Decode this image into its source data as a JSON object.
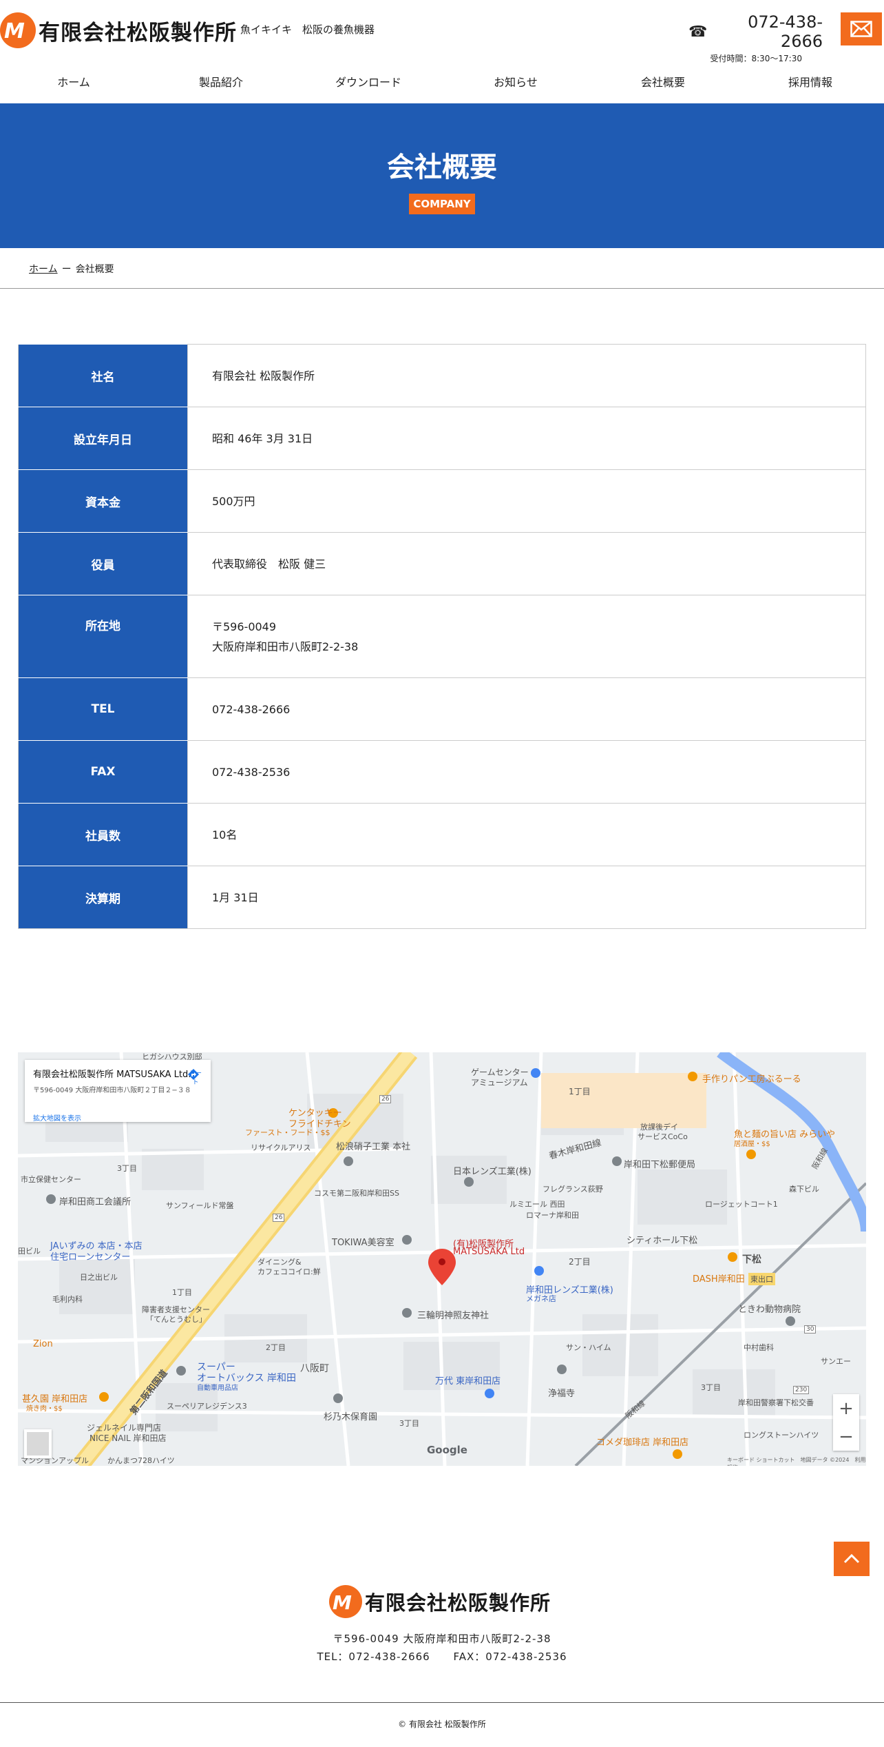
{
  "header": {
    "logo_text": "有限会社松阪製作所",
    "tagline": "魚イキイキ　松阪の養魚機器",
    "phone_icon": "☎",
    "phone": "072-438-2666",
    "hours": "受付時間：8:30〜17:30",
    "mail_icon": "envelope-icon"
  },
  "nav": {
    "items": [
      "ホーム",
      "製品紹介",
      "ダウンロード",
      "お知らせ",
      "会社概要",
      "採用情報"
    ]
  },
  "hero": {
    "title": "会社概要",
    "badge": "COMPANY"
  },
  "breadcrumb": {
    "home": "ホーム",
    "separator": "ー",
    "current": "会社概要"
  },
  "company_table": {
    "rows": [
      {
        "label": "社名",
        "value": "有限会社 松阪製作所"
      },
      {
        "label": "設立年月日",
        "value": "昭和 46年 3月 31日"
      },
      {
        "label": "資本金",
        "value": "500万円"
      },
      {
        "label": "役員",
        "value": "代表取締役　松阪 健三"
      },
      {
        "label": "所在地",
        "value": "〒596-0049",
        "value2": "大阪府岸和田市八阪町2-2-38"
      },
      {
        "label": "TEL",
        "value": "072-438-2666"
      },
      {
        "label": "FAX",
        "value": "072-438-2536"
      },
      {
        "label": "社員数",
        "value": "10名"
      },
      {
        "label": "決算期",
        "value": "1月 31日"
      }
    ]
  },
  "map": {
    "card_title": "有限会社松阪製作所 MATSUSAKA Ltd.",
    "card_address": "〒596-0049 大阪府岸和田市八阪町２丁目２−３８",
    "card_link": "拡大地図を表示",
    "card_directions": "ルート",
    "marker_label_1": "(有)松阪製作所",
    "marker_label_2": "MATSUSAKA Ltd",
    "labels": {
      "kentucky_1": "ケンタッキー",
      "kentucky_2": "フライドチキン",
      "kentucky_3": "ファースト・フード・$$",
      "game": "ゲームセンター",
      "game2": "アミュージアム",
      "chome1": "1丁目",
      "chome3": "3丁目",
      "chome2": "2丁目",
      "pan": "手作りパン工房ぶるーる",
      "matsunami": "松浪硝子工業 本社",
      "nihon_lens": "日本レンズ工業(株)",
      "haruki": "春木岸和田線",
      "post": "岸和田下松郵便局",
      "kishiwada_chamber": "岸和田商工会議所",
      "ja": "JAいずみの 本店・本店",
      "ja2": "住宅ローンセンター",
      "tokiwa": "TOKIWA美容室",
      "lens2": "岸和田レンズ工業(株)",
      "lens3": "メガネ店",
      "citihall": "シティホール下松",
      "shimomatsu": "下松",
      "higashiguchi": "東出口",
      "dash": "DASH岸和田",
      "zoo": "ときわ動物病院",
      "miwa": "三輪明神照友神社",
      "kokudo": "第二阪和国道",
      "super": "スーパー",
      "autobacs": "オートバックス 岸和田",
      "autobacs2": "自動車用品店",
      "yasaka": "八阪町",
      "suginoki": "杉乃木保育園",
      "mandai": "万代 東岸和田店",
      "jofuku": "浄福寺",
      "komeda": "コメダ珈琲店 岸和田店",
      "police": "岸和田警察署下松交番",
      "longstone": "ロングストーンハイツ",
      "sanai": "サンエー",
      "nakamura": "中村歯科",
      "udon": "魚と麺の旨い店 みらいや",
      "udon2": "居酒屋・$$",
      "morishita": "森下ビル",
      "rosejet": "ロージェットコート1",
      "lumiere": "ルミエール 西田",
      "romana": "ロマーナ岸和田",
      "fragrance": "フレグランス荻野",
      "houkago": "放課後デイ",
      "houkago2": "サービスCoCo",
      "recycle": "リサイクルアリス",
      "cosmo": "コスモ第二阪和岸和田SS",
      "sunfield": "サンフィールド常盤",
      "health": "市立保健センター",
      "dining": "ダイニング&",
      "dining2": "カフェココイロ:鮮",
      "hidechi": "日之出ビル",
      "mouri": "毛利内科",
      "shogai": "障害者支援センター",
      "shogai2": "「てんとうむし」",
      "sunheim": "サン・ハイム",
      "superia": "スーペリアレジデンス3",
      "jelnail": "ジェルネイル専門店",
      "nicenail": "NICE NAIL 岸和田店",
      "mansion": "マンションアップル",
      "kanmatsu": "かんまつ728ハイツ",
      "yakiniku": "甚久園 岸和田店",
      "yakiniku2": "焼き肉・$$",
      "zion": "Zion",
      "hankai": "阪和線",
      "road26": "26",
      "road30": "30",
      "road230": "230",
      "hidechibiru": "田ビル",
      "higashi": "ヒガシハウス別邸"
    },
    "google": "Google",
    "footer_text": "キーボード ショートカット　地図データ ©2024　利用規約",
    "zoom_in": "+",
    "zoom_out": "−"
  },
  "footer": {
    "logo_text": "有限会社松阪製作所",
    "address": "〒596-0049 大阪府岸和田市八阪町2-2-38",
    "tel": "TEL：072-438-2666",
    "fax": "FAX：072-438-2536",
    "copyright": "© 有限会社 松阪製作所"
  },
  "colors": {
    "brand_blue": "#1f5bb3",
    "brand_orange": "#f26b1d"
  }
}
